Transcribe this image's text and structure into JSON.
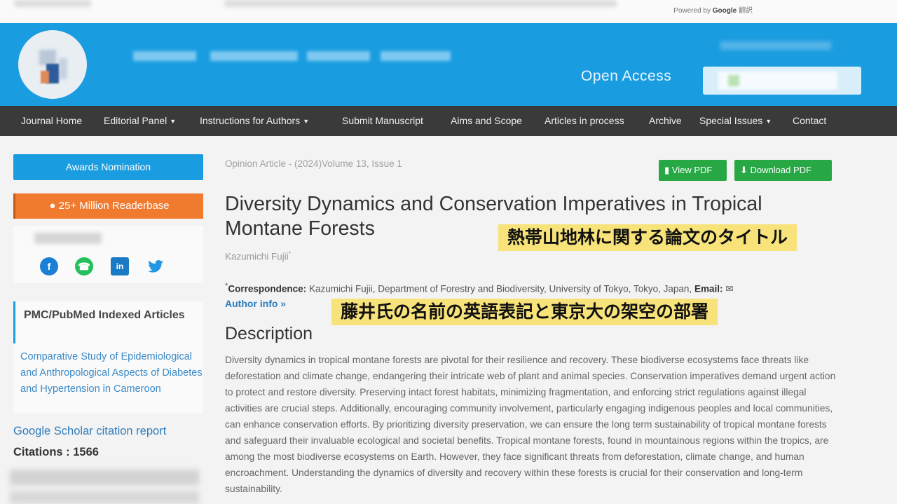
{
  "topbar": {
    "powered_prefix": "Powered by",
    "powered_brand": "Google",
    "powered_suffix": "翻訳"
  },
  "header": {
    "open_access": "Open Access"
  },
  "nav": [
    {
      "label": "Journal Home",
      "dropdown": false
    },
    {
      "label": "Editorial Panel",
      "dropdown": true
    },
    {
      "label": "Instructions for Authors",
      "dropdown": true
    },
    {
      "label": "Submit Manuscript",
      "dropdown": false
    },
    {
      "label": "Aims and Scope",
      "dropdown": false
    },
    {
      "label": "Articles in process",
      "dropdown": false
    },
    {
      "label": "Archive",
      "dropdown": false
    },
    {
      "label": "Special Issues",
      "dropdown": true
    },
    {
      "label": "Contact",
      "dropdown": false
    }
  ],
  "sidebar": {
    "awards_label": "Awards Nomination",
    "readerbase_label": "25+ Million Readerbase",
    "social": [
      "facebook-icon",
      "whatsapp-icon",
      "linkedin-icon",
      "twitter-icon"
    ],
    "pmc_title": "PMC/PubMed Indexed Articles",
    "pmc_article": "Comparative Study of Epidemiological and Anthropological Aspects of Diabetes and Hypertension in Cameroon",
    "scholar_link": "Google Scholar citation report",
    "citations": "Citations : 1566"
  },
  "article": {
    "meta": "Opinion Article - (2024)Volume 13, Issue 1",
    "view_pdf": "View PDF",
    "download_pdf": "Download PDF",
    "title": "Diversity Dynamics and Conservation Imperatives in Tropical Montane Forests",
    "author": "Kazumichi Fujii",
    "author_mark": "*",
    "correspondence_label": "Correspondence:",
    "correspondence_text": "Kazumichi Fujii, Department of Forestry and Biodiversity, University of Tokyo, Tokyo, Japan,",
    "email_label": "Email:",
    "author_info": "Author info »",
    "description_heading": "Description",
    "description": "Diversity dynamics in tropical montane forests are pivotal for their resilience and recovery. These biodiverse ecosystems face threats like deforestation and climate change, endangering their intricate web of plant and animal species. Conservation imperatives demand urgent action to protect and restore diversity. Preserving intact forest habitats, minimizing fragmentation, and enforcing strict regulations against illegal activities are crucial steps. Additionally, encouraging community involvement, particularly engaging indigenous peoples and local communities, can enhance conservation efforts. By prioritizing diversity preservation, we can ensure the long term sustainability of tropical montane forests and safeguard their invaluable ecological and societal benefits. Tropical montane forests, found in mountainous regions within the tropics, are among the most biodiverse ecosystems on Earth. However, they face significant threats from deforestation, climate change, and human encroachment. Understanding the dynamics of diversity and recovery within these forests is crucial for their conservation and long-term sustainability."
  },
  "captions": {
    "title_caption": "熱帯山地林に関する論文のタイトル",
    "author_caption": "藤井氏の名前の英語表記と東京大の架空の部署"
  },
  "colors": {
    "header": "#1a9de0",
    "nav": "#3a3a3a",
    "pdf": "#28a745",
    "readerbase": "#f07a2e",
    "caption": "#f7e37a"
  }
}
